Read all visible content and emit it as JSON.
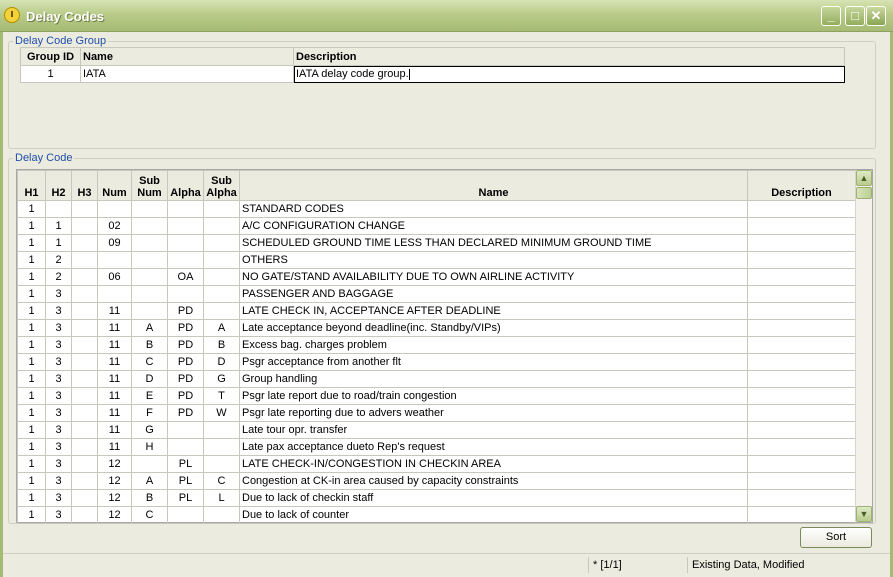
{
  "window": {
    "title": "Delay Codes"
  },
  "group_section": {
    "legend": "Delay Code Group",
    "columns": [
      "Group ID",
      "Name",
      "Description"
    ],
    "rows": [
      [
        "1",
        "IATA",
        "IATA delay code group."
      ]
    ]
  },
  "code_section": {
    "legend": "Delay Code",
    "columns": {
      "h1": "H1",
      "h2": "H2",
      "h3": "H3",
      "num": "Num",
      "subnum_1": "Sub",
      "subnum_2": "Num",
      "alpha": "Alpha",
      "subalpha_1": "Sub",
      "subalpha_2": "Alpha",
      "name": "Name",
      "description": "Description"
    },
    "rows": [
      [
        "1",
        "",
        "",
        "",
        "",
        "",
        "",
        "STANDARD CODES",
        ""
      ],
      [
        "1",
        "1",
        "",
        "02",
        "",
        "",
        "",
        "A/C CONFIGURATION CHANGE",
        ""
      ],
      [
        "1",
        "1",
        "",
        "09",
        "",
        "",
        "",
        "SCHEDULED GROUND TIME LESS THAN DECLARED MINIMUM  GROUND TIME",
        ""
      ],
      [
        "1",
        "2",
        "",
        "",
        "",
        "",
        "",
        "OTHERS",
        ""
      ],
      [
        "1",
        "2",
        "",
        "06",
        "",
        "OA",
        "",
        "NO GATE/STAND AVAILABILITY DUE TO OWN AIRLINE ACTIVITY",
        ""
      ],
      [
        "1",
        "3",
        "",
        "",
        "",
        "",
        "",
        "PASSENGER AND BAGGAGE",
        ""
      ],
      [
        "1",
        "3",
        "",
        "11",
        "",
        "PD",
        "",
        "LATE CHECK IN, ACCEPTANCE AFTER DEADLINE",
        ""
      ],
      [
        "1",
        "3",
        "",
        "11",
        "A",
        "PD",
        "A",
        "Late acceptance beyond deadline(inc. Standby/VIPs)",
        ""
      ],
      [
        "1",
        "3",
        "",
        "11",
        "B",
        "PD",
        "B",
        "Excess bag. charges problem",
        ""
      ],
      [
        "1",
        "3",
        "",
        "11",
        "C",
        "PD",
        "D",
        "Psgr acceptance from another flt",
        ""
      ],
      [
        "1",
        "3",
        "",
        "11",
        "D",
        "PD",
        "G",
        "Group handling",
        ""
      ],
      [
        "1",
        "3",
        "",
        "11",
        "E",
        "PD",
        "T",
        "Psgr late report due to road/train congestion",
        ""
      ],
      [
        "1",
        "3",
        "",
        "11",
        "F",
        "PD",
        "W",
        "Psgr late reporting due to advers weather",
        ""
      ],
      [
        "1",
        "3",
        "",
        "11",
        "G",
        "",
        "",
        "Late tour opr. transfer",
        ""
      ],
      [
        "1",
        "3",
        "",
        "11",
        "H",
        "",
        "",
        "Late pax acceptance dueto Rep's request",
        ""
      ],
      [
        "1",
        "3",
        "",
        "12",
        "",
        "PL",
        "",
        "LATE CHECK-IN/CONGESTION IN CHECKIN AREA",
        ""
      ],
      [
        "1",
        "3",
        "",
        "12",
        "A",
        "PL",
        "C",
        "Congestion at CK-in area caused by capacity constraints",
        ""
      ],
      [
        "1",
        "3",
        "",
        "12",
        "B",
        "PL",
        "L",
        "Due to lack of checkin staff",
        ""
      ],
      [
        "1",
        "3",
        "",
        "12",
        "C",
        "",
        "",
        "Due to lack of counter",
        ""
      ]
    ]
  },
  "buttons": {
    "sort": "Sort"
  },
  "status": {
    "record": "* [1/1]",
    "state": "Existing Data, Modified"
  }
}
